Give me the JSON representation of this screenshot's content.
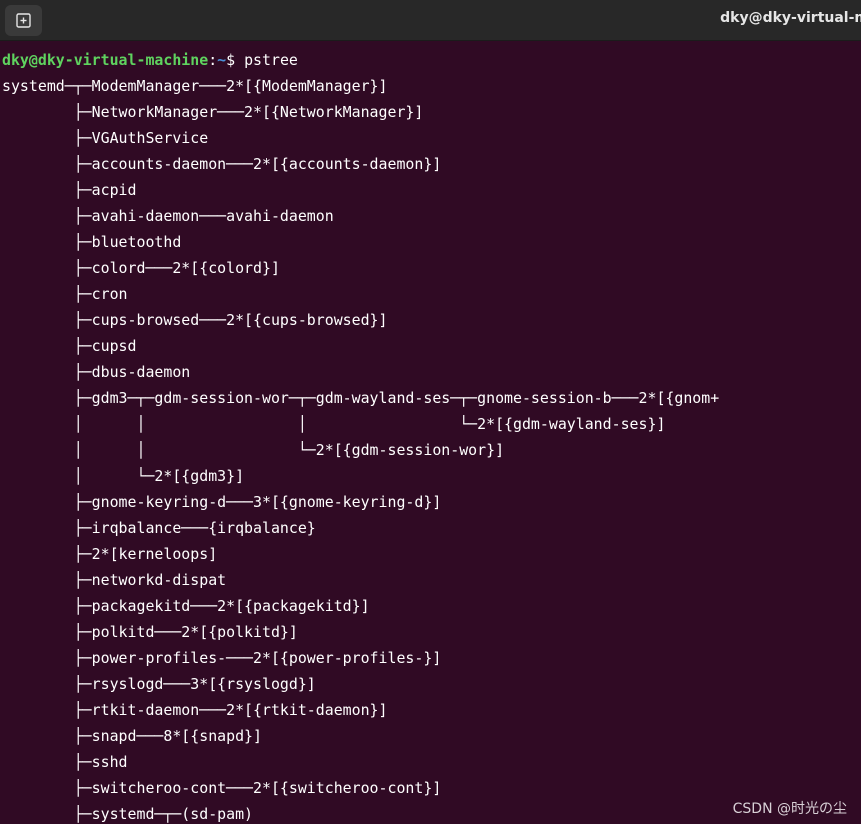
{
  "window": {
    "title": "dky@dky-virtual-m",
    "new_tab_icon": "new-tab-icon"
  },
  "prompt": {
    "user_host": "dky@dky-virtual-machine",
    "colon": ":",
    "dir": "~",
    "symbol": "$ ",
    "command": "pstree"
  },
  "output_lines": [
    "systemd─┬─ModemManager───2*[{ModemManager}]",
    "        ├─NetworkManager───2*[{NetworkManager}]",
    "        ├─VGAuthService",
    "        ├─accounts-daemon───2*[{accounts-daemon}]",
    "        ├─acpid",
    "        ├─avahi-daemon───avahi-daemon",
    "        ├─bluetoothd",
    "        ├─colord───2*[{colord}]",
    "        ├─cron",
    "        ├─cups-browsed───2*[{cups-browsed}]",
    "        ├─cupsd",
    "        ├─dbus-daemon",
    "        ├─gdm3─┬─gdm-session-wor─┬─gdm-wayland-ses─┬─gnome-session-b───2*[{gnom+",
    "        │      │                 │                 └─2*[{gdm-wayland-ses}]",
    "        │      │                 └─2*[{gdm-session-wor}]",
    "        │      └─2*[{gdm3}]",
    "        ├─gnome-keyring-d───3*[{gnome-keyring-d}]",
    "        ├─irqbalance───{irqbalance}",
    "        ├─2*[kerneloops]",
    "        ├─networkd-dispat",
    "        ├─packagekitd───2*[{packagekitd}]",
    "        ├─polkitd───2*[{polkitd}]",
    "        ├─power-profiles-───2*[{power-profiles-}]",
    "        ├─rsyslogd───3*[{rsyslogd}]",
    "        ├─rtkit-daemon───2*[{rtkit-daemon}]",
    "        ├─snapd───8*[{snapd}]",
    "        ├─sshd",
    "        ├─switcheroo-cont───2*[{switcheroo-cont}]",
    "        ├─systemd─┬─(sd-pam)"
  ],
  "watermark": "CSDN @时光の尘",
  "colors": {
    "terminal_bg": "#300a24",
    "titlebar_bg": "#282828",
    "prompt_user": "#5fd35f",
    "prompt_dir": "#4a90d9",
    "text": "#ffffff"
  }
}
